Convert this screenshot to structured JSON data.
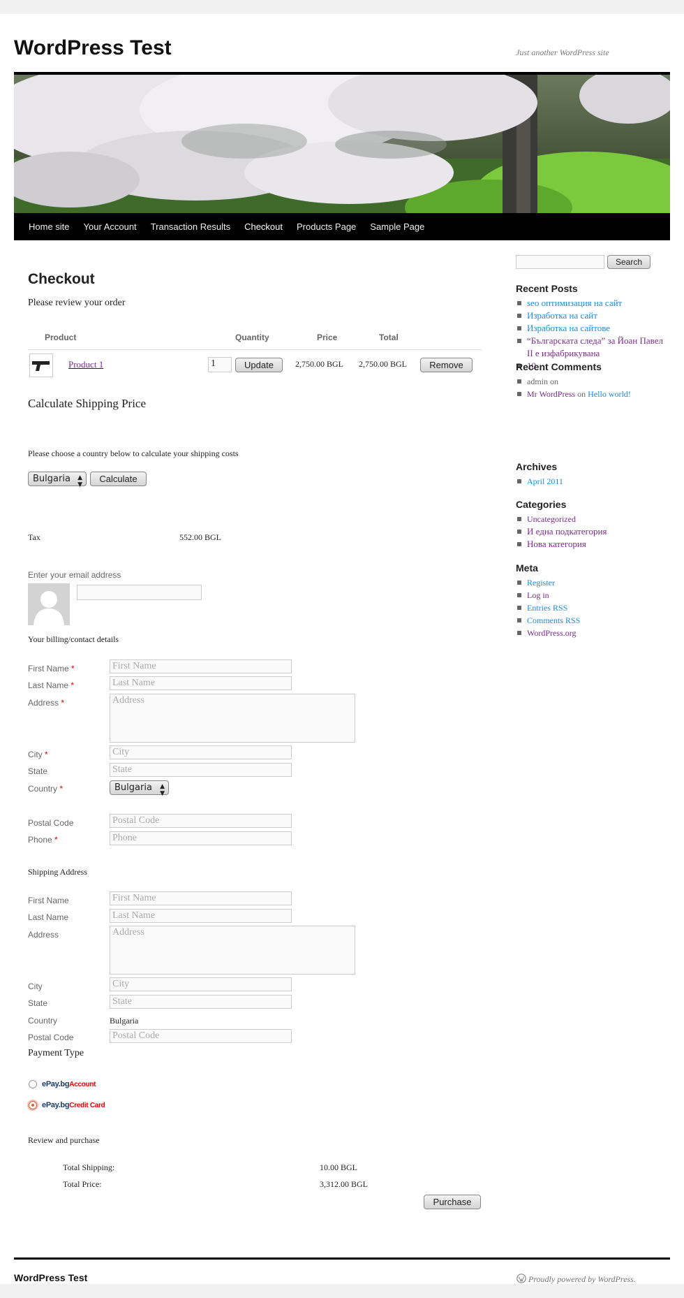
{
  "site": {
    "title": "WordPress Test",
    "tagline": "Just another WordPress site"
  },
  "nav": [
    "Home site",
    "Your Account",
    "Transaction Results",
    "Checkout",
    "Products Page",
    "Sample Page"
  ],
  "checkout": {
    "title": "Checkout",
    "review_text": "Please review your order",
    "table_headers": {
      "product": "Product",
      "quantity": "Quantity",
      "price": "Price",
      "total": "Total"
    },
    "item": {
      "name": "Product 1",
      "quantity": "1",
      "update_label": "Update",
      "price": "2,750.00 BGL",
      "total": "2,750.00 BGL",
      "remove_label": "Remove"
    },
    "shipping_title": "Calculate Shipping Price",
    "shipping_text": "Please choose a country below to calculate your shipping costs",
    "country_selected": "Bulgaria",
    "calculate_label": "Calculate",
    "tax_label": "Tax",
    "tax_value": "552.00 BGL",
    "email_label": "Enter your email address",
    "billing_title": "Your billing/contact details",
    "billing": {
      "first_name": "First Name",
      "last_name": "Last Name",
      "address": "Address",
      "city": "City",
      "state": "State",
      "country": "Country",
      "postal_code": "Postal Code",
      "phone": "Phone"
    },
    "required_mark": "*",
    "billing_country": "Bulgaria",
    "shipping_address_title": "Shipping Address",
    "shipping_country_value": "Bulgaria",
    "payment_title": "Payment Type",
    "payment_options": [
      {
        "brand": "ePay.bg",
        "suffix": "Account",
        "selected": false
      },
      {
        "brand": "ePay.bg",
        "suffix": "Credit Card",
        "selected": true
      }
    ],
    "review_purchase": "Review and purchase",
    "total_shipping_label": "Total Shipping:",
    "total_shipping_value": "10.00 BGL",
    "total_price_label": "Total Price:",
    "total_price_value": "3,312.00 BGL",
    "purchase_label": "Purchase"
  },
  "sidebar": {
    "search_label": "Search",
    "recent_posts_title": "Recent Posts",
    "recent_posts": [
      "seo оптимизация на сайт",
      "Изработка на сайт",
      "Изработка на сайтове",
      "“Българската следа” за Йоан Павел II е изфабрикувана",
      "10"
    ],
    "recent_comments_title": "Recent Comments",
    "comment1": "admin on",
    "comment2_author": "Mr WordPress",
    "comment2_on": "on",
    "comment2_post": "Hello world!",
    "archives_title": "Archives",
    "archives": [
      "April 2011"
    ],
    "categories_title": "Categories",
    "categories": [
      "Uncategorized",
      "И една подкатегория",
      "Нова категория"
    ],
    "meta_title": "Meta",
    "meta": [
      "Register",
      "Log in",
      "Entries RSS",
      "Comments RSS",
      "WordPress.org"
    ]
  },
  "footer": {
    "title": "WordPress Test",
    "credit": "Proudly powered by WordPress."
  }
}
